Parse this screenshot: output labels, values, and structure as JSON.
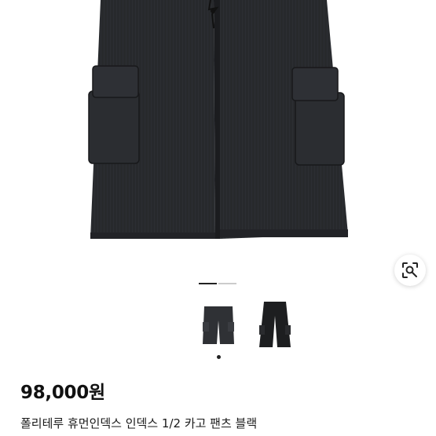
{
  "product": {
    "price": "98,000원",
    "title": "폴리테루 휴먼인덱스 인덱스 1/2 카고 팬츠 블랙"
  },
  "gallery": {
    "image_count": 2,
    "current_index": 1,
    "thumbnails": [
      "cargo-shorts-thumbnail",
      "cargo-pants-thumbnail"
    ]
  },
  "icons": {
    "lens": "image-search-icon"
  },
  "colors": {
    "product_fabric": "#27292c",
    "pager_active": "#222222",
    "pager_inactive": "#cccccc",
    "price_text": "#111111",
    "dot": "#222222"
  }
}
